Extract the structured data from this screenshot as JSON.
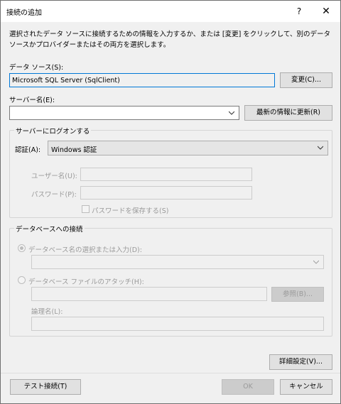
{
  "window": {
    "title": "接続の追加",
    "help_glyph": "?",
    "close_glyph": "✕"
  },
  "description": "選択されたデータ ソースに接続するための情報を入力するか、または [変更] をクリックして、別のデータ ソースかプロバイダーまたはその両方を選択します。",
  "data_source": {
    "label": "データ ソース(S):",
    "value": "Microsoft SQL Server (SqlClient)",
    "change_button": "変更(C)..."
  },
  "server": {
    "label": "サーバー名(E):",
    "value": "",
    "refresh_button": "最新の情報に更新(R)"
  },
  "logon": {
    "group_title": "サーバーにログオンする",
    "auth_label": "認証(A):",
    "auth_value": "Windows 認証",
    "username_label": "ユーザー名(U):",
    "username_value": "",
    "password_label": "パスワード(P):",
    "password_value": "",
    "save_password_label": "パスワードを保存する(S)",
    "save_password_checked": false
  },
  "database": {
    "group_title": "データベースへの接続",
    "select_radio_label": "データベース名の選択または入力(D):",
    "select_radio_checked": true,
    "db_name_value": "",
    "attach_radio_label": "データベース ファイルのアタッチ(H):",
    "attach_radio_checked": false,
    "attach_file_value": "",
    "browse_button": "参照(B)...",
    "logical_name_label": "論理名(L):",
    "logical_name_value": ""
  },
  "advanced_button": "詳細設定(V)...",
  "footer": {
    "test_button": "テスト接続(T)",
    "ok_button": "OK",
    "cancel_button": "キャンセル"
  },
  "icons": {
    "dropdown": "chevron-down-icon"
  }
}
